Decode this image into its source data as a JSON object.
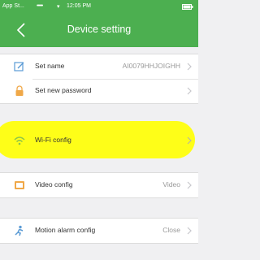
{
  "status_bar": {
    "app_back": "App St...",
    "signal": "•••••",
    "time": "12:05 PM"
  },
  "nav": {
    "title": "Device setting"
  },
  "items": [
    {
      "label": "Set name",
      "value": "AI0079HHJOIGHH",
      "icon": "edit-icon"
    },
    {
      "label": "Set new password",
      "value": "",
      "icon": "lock-icon"
    },
    {
      "label": "Wi-Fi config",
      "value": "",
      "icon": "wifi-icon"
    },
    {
      "label": "Video config",
      "value": "Video",
      "icon": "video-icon"
    },
    {
      "label": "Motion alarm config",
      "value": "Close",
      "icon": "motion-icon"
    }
  ],
  "colors": {
    "header": "#4caf50",
    "icon_green": "#8bc34a",
    "icon_orange": "#f0a848",
    "icon_blue": "#5b9bd5",
    "highlight": "#ffff00"
  }
}
